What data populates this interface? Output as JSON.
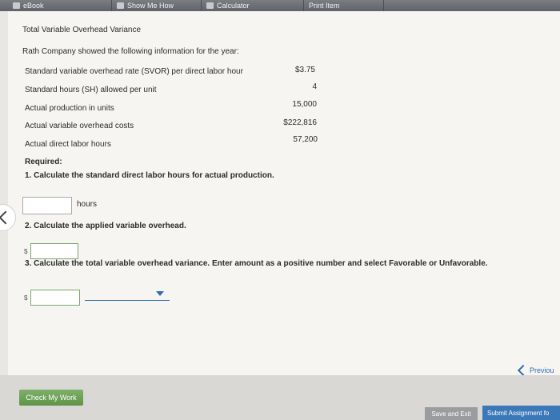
{
  "toolbar": {
    "ebook": "eBook",
    "show_me_how": "Show Me How",
    "calculator": "Calculator",
    "print_item": "Print Item"
  },
  "problem": {
    "title": "Total Variable Overhead Variance",
    "intro": "Rath Company showed the following information for the year:",
    "rows": [
      {
        "label": "Standard variable overhead rate (SVOR) per direct labor hour",
        "value": "$3.75"
      },
      {
        "label": "Standard hours (SH) allowed per unit",
        "value": "4"
      },
      {
        "label": "Actual production in units",
        "value": "15,000"
      },
      {
        "label": "Actual variable overhead costs",
        "value": "$222,816"
      },
      {
        "label": "Actual direct labor hours",
        "value": "57,200"
      }
    ],
    "required_label": "Required:",
    "q1": "1. Calculate the standard direct labor hours for actual production.",
    "q1_unit": "hours",
    "q1_value": "",
    "q2": "2. Calculate the applied variable overhead.",
    "q2_value": "",
    "q3": "3. Calculate the total variable overhead variance. Enter amount as a positive number and select Favorable or Unfavorable.",
    "q3_value": "",
    "q3_select_value": "",
    "currency": "$"
  },
  "nav": {
    "previous": "Previou"
  },
  "footer": {
    "check_my_work": "Check My Work",
    "save_and_exit": "Save and Exit",
    "submit": "Submit Assignment fo"
  },
  "colors": {
    "accent": "#2f6fb0",
    "check_green": "#6aa253",
    "submit_blue": "#3b78b8"
  }
}
